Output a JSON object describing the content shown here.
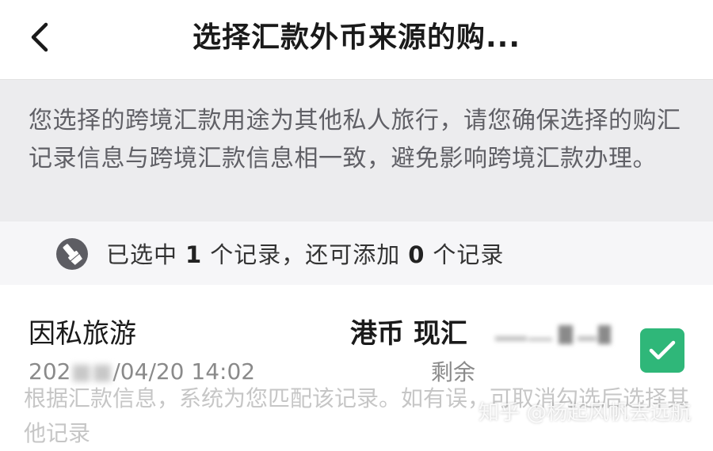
{
  "header": {
    "title": "选择汇款外币来源的购...",
    "back_icon": "chevron-left-icon"
  },
  "notice": {
    "text": "您选择的跨境汇款用途为其他私人旅行，请您确保选择的购汇记录信息与跨境汇款信息相一致，避免影响跨境汇款办理。"
  },
  "selection": {
    "icon": "brush-icon",
    "prefix": "已选中",
    "selected_count": "1",
    "middle": "个记录，还可添加",
    "remaining_count": "0",
    "suffix": "个记录"
  },
  "record": {
    "purpose": "因私旅游",
    "currency": "港币 现汇",
    "date_start": "202",
    "date_end": "/04/20 14:02",
    "remaining_label": "剩余",
    "checked": true,
    "check_color": "#2fb779"
  },
  "hint": {
    "text": "根据汇款信息，系统为您匹配该记录。如有误，可取消勾选后选择其他记录"
  },
  "watermark": {
    "text": "知乎 @杨起风帆去远航"
  }
}
